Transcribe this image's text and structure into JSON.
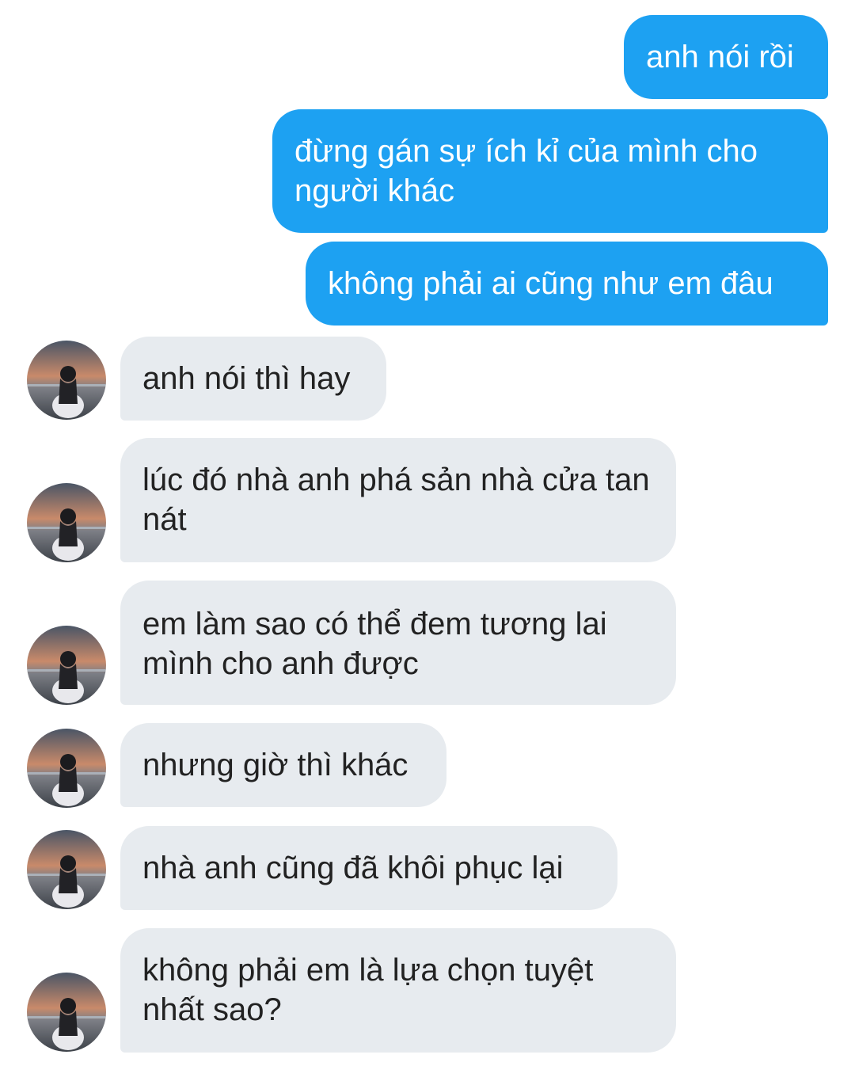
{
  "conversation": {
    "sent": [
      {
        "text": "anh nói rồi"
      },
      {
        "text": "đừng gán sự ích kỉ của mình cho người khác"
      },
      {
        "text": "không phải ai cũng như em đâu"
      }
    ],
    "received": [
      {
        "text": "anh nói thì hay"
      },
      {
        "text": "lúc đó nhà anh phá sản nhà cửa tan nát"
      },
      {
        "text": "em làm sao có thể đem tương lai mình cho anh được"
      },
      {
        "text": "nhưng giờ thì khác"
      },
      {
        "text": "nhà anh cũng đã khôi phục lại"
      },
      {
        "text": "không phải em là lựa chọn tuyệt nhất sao?"
      }
    ]
  },
  "colors": {
    "sent_bubble": "#1da1f2",
    "sent_text": "#ffffff",
    "received_bubble": "#e7ebef",
    "received_text": "#222222",
    "background": "#ffffff"
  },
  "icons": {
    "avatar": "profile-photo-sunset-silhouette"
  }
}
